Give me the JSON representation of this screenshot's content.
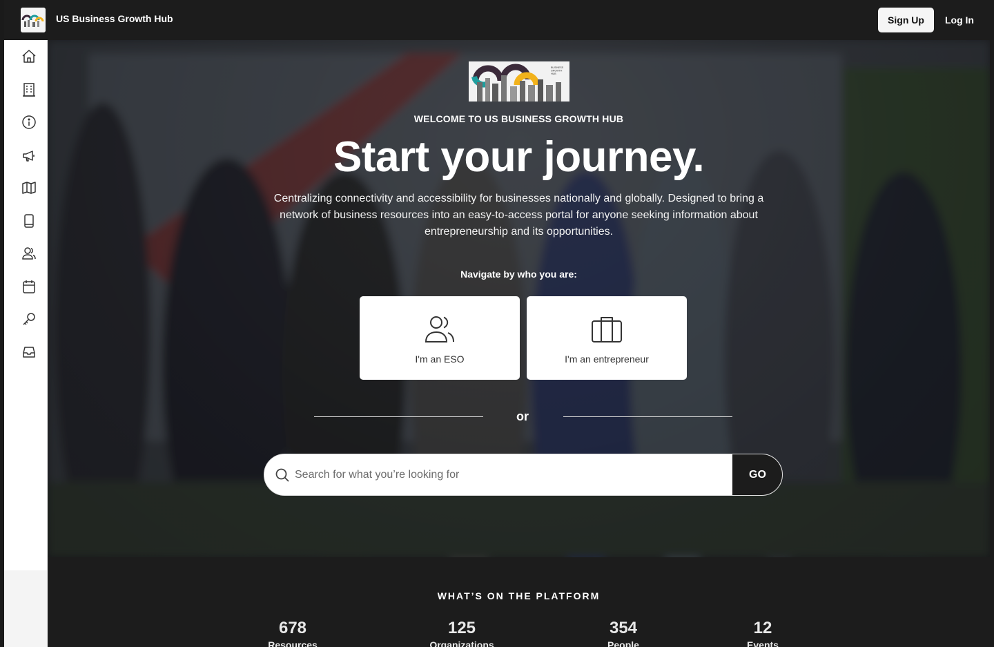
{
  "header": {
    "brand": "US Business Growth Hub",
    "signup_label": "Sign Up",
    "login_label": "Log In"
  },
  "sidebar": {
    "items": [
      {
        "icon": "home-icon"
      },
      {
        "icon": "building-icon"
      },
      {
        "icon": "info-icon"
      },
      {
        "icon": "megaphone-icon"
      },
      {
        "icon": "map-icon"
      },
      {
        "icon": "book-icon"
      },
      {
        "icon": "users-icon"
      },
      {
        "icon": "calendar-icon"
      },
      {
        "icon": "key-icon"
      },
      {
        "icon": "inbox-icon"
      }
    ]
  },
  "hero": {
    "welcome": "WELCOME TO US BUSINESS GROWTH HUB",
    "headline": "Start your journey.",
    "description": "Centralizing connectivity and accessibility for businesses nationally and globally. Designed to bring a network of business resources into an easy-to-access portal for anyone seeking information about entrepreneurship and its opportunities.",
    "navigate_label": "Navigate by who you are:",
    "cards": [
      {
        "label": "I'm an ESO",
        "icon": "users-icon"
      },
      {
        "label": "I'm an entrepreneur",
        "icon": "briefcase-icon"
      }
    ],
    "or_label": "or",
    "search": {
      "placeholder": "Search for what you’re looking for",
      "value": "",
      "go_label": "GO"
    }
  },
  "stats": {
    "title": "WHAT’S ON THE PLATFORM",
    "items": [
      {
        "value": "678",
        "label": "Resources"
      },
      {
        "value": "125",
        "label": "Organizations"
      },
      {
        "value": "354",
        "label": "People"
      },
      {
        "value": "12",
        "label": "Events"
      }
    ]
  },
  "colors": {
    "topbar": "#1c1c1c",
    "accent_teal": "#1f9e9e",
    "accent_yellow": "#f2b21b"
  }
}
